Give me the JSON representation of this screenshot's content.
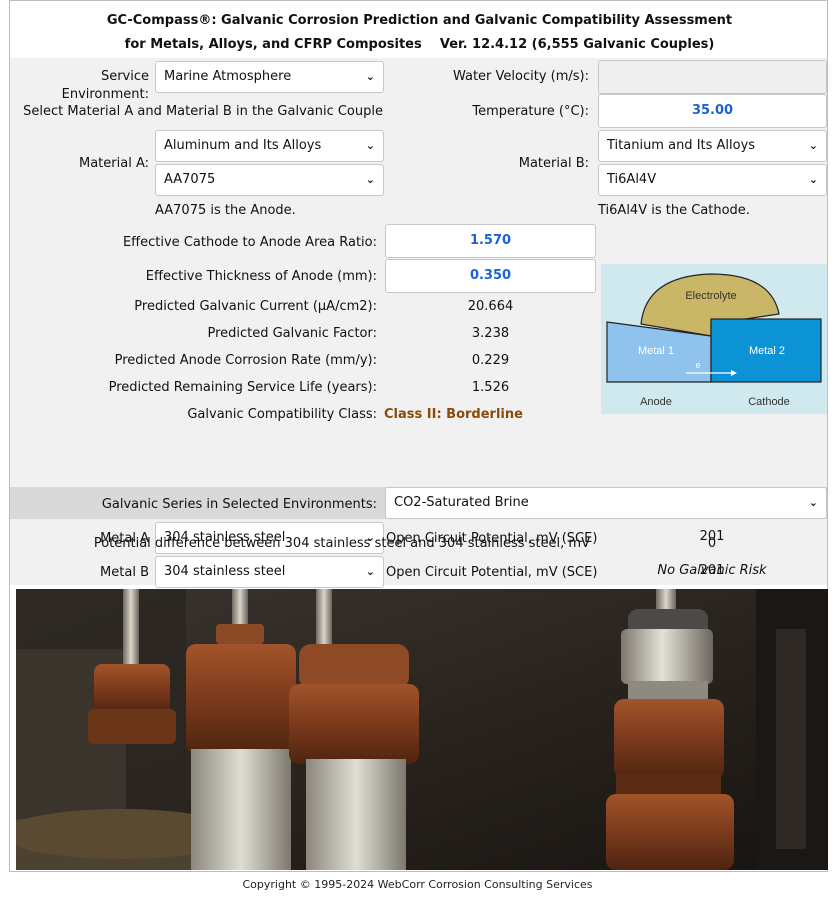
{
  "header": {
    "title_line1": "GC-Compass®: Galvanic Corrosion Prediction and Galvanic Compatibility Assessment",
    "title_line2": "for Metals, Alloys, and CFRP Composites    Ver. 12.4.12 (6,555 Galvanic Couples)"
  },
  "form": {
    "service_env_label": "Service Environment:",
    "service_env_value": "Marine Atmosphere",
    "water_velocity_label": "Water Velocity (m/s):",
    "water_velocity_value": "",
    "select_instruction": "Select Material A and Material B in the Galvanic Couple",
    "temperature_label": "Temperature (°C):",
    "temperature_value": "35.00",
    "material_a_label": "Material A:",
    "material_a_group": "Aluminum and Its Alloys",
    "material_a_alloy": "AA7075",
    "material_b_label": "Material B:",
    "material_b_group": "Titanium and Its Alloys",
    "material_b_alloy": "Ti6Al4V",
    "anode_note": "AA7075 is the Anode.",
    "cathode_note": "Ti6Al4V is the Cathode.",
    "area_ratio_label": "Effective Cathode to Anode Area Ratio:",
    "area_ratio_value": "1.570",
    "thickness_label": "Effective Thickness of Anode (mm):",
    "thickness_value": "0.350"
  },
  "results": {
    "current_label": "Predicted Galvanic Current (μA/cm2):",
    "current_value": "20.664",
    "factor_label": "Predicted Galvanic Factor:",
    "factor_value": "3.238",
    "rate_label": "Predicted Anode Corrosion Rate (mm/y):",
    "rate_value": "0.229",
    "life_label": "Predicted Remaining Service Life (years):",
    "life_value": "1.526",
    "class_label": "Galvanic Compatibility Class:",
    "class_value": "Class II: Borderline"
  },
  "diagram": {
    "electrolyte": "Electrolyte",
    "metal1": "Metal 1",
    "metal2": "Metal 2",
    "electron": "e",
    "anode": "Anode",
    "cathode": "Cathode",
    "colors": {
      "sea": "#cfe9ee",
      "electrolyte": "#c9b767",
      "metal1": "#8fc3ee",
      "metal2": "#0b93d6"
    }
  },
  "series": {
    "env_label": "Galvanic Series in Selected Environments:",
    "env_value": "CO2-Saturated Brine",
    "metal_a_label": "Metal A",
    "metal_a_value": "304 stainless steel",
    "metal_b_label": "Metal B",
    "metal_b_value": "304 stainless steel",
    "ocp_label": "Open Circuit Potential, mV (SCE)",
    "ocp_a_value": "201",
    "ocp_b_value": "201",
    "diff_label": "Potential difference between 304 stainless steel and 304 stainless steel, mV",
    "diff_value": "0",
    "risk": "No Galvanic Risk"
  },
  "footer": {
    "copyright": "Copyright © 1995-2024 WebCorr Corrosion Consulting Services"
  }
}
